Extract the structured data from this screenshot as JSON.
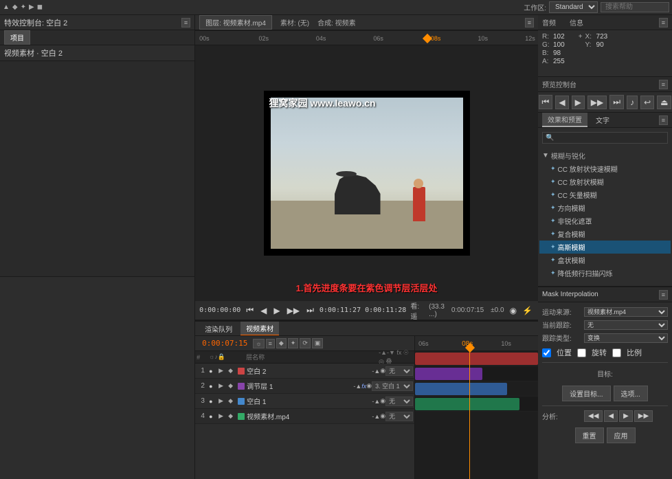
{
  "app": {
    "workspace": "Standard",
    "search_placeholder": "搜索帮助"
  },
  "top_toolbar": {
    "icons": [
      "◀",
      "▶",
      "■",
      "●",
      "◆"
    ]
  },
  "effect_controls": {
    "label": "特效控制台: 空白 2",
    "sub_label": "视频素材 · 空白 2",
    "tabs": [
      "项目"
    ]
  },
  "preview": {
    "tabs": [
      "图层: 视频素材.mp4"
    ],
    "source_label": "素材: (无)",
    "composition_label": "合成: 视频素",
    "watermark": "狸窝家园 www.leawo.cn",
    "time_current": "0:00:00:00",
    "time_duration": "0:00:11:27",
    "time_remaining": "0:00:11:28",
    "view_label": "查看: 遥盖",
    "resolution": "(33.3 ...)",
    "frame_time": "0:00:07:15",
    "zoom": "±0.0",
    "ruler_marks": [
      "00s",
      "02s",
      "04s",
      "06s",
      "08s",
      "10s",
      "12s"
    ]
  },
  "audio_info": {
    "title": "音频",
    "info_title": "信息",
    "r_label": "R:",
    "r_val": "102",
    "g_label": "G:",
    "g_val": "100",
    "b_label": "B:",
    "b_val": "98",
    "a_label": "A:",
    "a_val": "255",
    "x_label": "X:",
    "x_val": "723",
    "y_label": "Y:",
    "y_val": "90"
  },
  "preview_controls_right": {
    "title": "预览控制台",
    "buttons": [
      "⏮",
      "◀",
      "▶",
      "▶▶",
      "⏭",
      "🔊",
      "↩",
      "⏏"
    ]
  },
  "effects": {
    "title": "效果和预置",
    "tabs": [
      "效果和预置",
      "文字"
    ],
    "search_placeholder": "🔍",
    "category": "模糊与锐化",
    "items": [
      {
        "name": "CC 放射状快速模糊",
        "icon": "✦"
      },
      {
        "name": "CC 放射状模糊",
        "icon": "✦"
      },
      {
        "name": "CC 矢量模糊",
        "icon": "✦"
      },
      {
        "name": "方向模糊",
        "icon": "✦"
      },
      {
        "name": "非锐化遮罩",
        "icon": "✦"
      },
      {
        "name": "复合模糊",
        "icon": "✦"
      },
      {
        "name": "高斯模糊",
        "icon": "✦",
        "highlighted": true
      },
      {
        "name": "盒状模糊",
        "icon": "✦"
      },
      {
        "name": "降低频行扫描闪烁",
        "icon": "✦"
      }
    ]
  },
  "tracker": {
    "title": "Mask Interpolation",
    "motion_source_label": "运动来源:",
    "motion_source_val": "视频素材.mp4",
    "current_track_label": "当前跟踪:",
    "current_track_val": "无",
    "track_type_label": "跟踪类型:",
    "track_type_val": "变换",
    "checkboxes": [
      "位置",
      "旋转",
      "比例"
    ],
    "target_label": "目标:",
    "set_target_btn": "设置目标...",
    "options_btn": "选项...",
    "analyze_label": "分析:",
    "analyze_btns": [
      "◀◀",
      "◀",
      "▶",
      "▶▶"
    ],
    "reset_btn": "重置",
    "apply_btn": "应用"
  },
  "timeline": {
    "tabs": [
      "渲染队列",
      "视频素材"
    ],
    "active_tab": "视频素材",
    "current_time": "0:00:07:15",
    "ruler_marks": [
      "06s",
      "08s",
      "10s"
    ],
    "layers": [
      {
        "num": "1",
        "color": "#cc4444",
        "name": "空白 2",
        "mode": "无",
        "parent": ""
      },
      {
        "num": "2",
        "color": "#8844aa",
        "name": "调节层 1",
        "mode": "3. 空白 1",
        "has_fx": true
      },
      {
        "num": "3",
        "color": "#4488cc",
        "name": "空白 1",
        "mode": "无",
        "parent": ""
      },
      {
        "num": "4",
        "color": "#33aa66",
        "name": "视频素材.mp4",
        "mode": "无",
        "parent": ""
      }
    ],
    "clips": [
      {
        "layer": 0,
        "left_pct": 0,
        "width_pct": 100,
        "color": "#cc3333"
      },
      {
        "layer": 1,
        "left_pct": 0,
        "width_pct": 55,
        "color": "#7733aa"
      },
      {
        "layer": 2,
        "left_pct": 0,
        "width_pct": 75,
        "color": "#3377bb"
      },
      {
        "layer": 3,
        "left_pct": 0,
        "width_pct": 85,
        "color": "#228855"
      }
    ],
    "instruction": "1.首先进度条要在紫色调节层活层处"
  }
}
